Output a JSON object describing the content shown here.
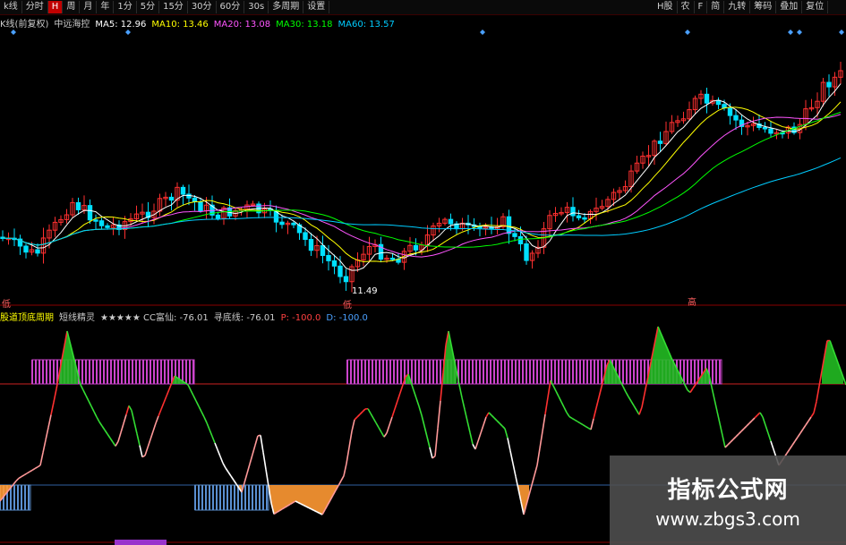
{
  "toolbar": {
    "left": [
      "k线",
      "分时",
      "H",
      "周",
      "月",
      "年",
      "1分",
      "5分",
      "15分",
      "30分",
      "60分",
      "30s",
      "多周期",
      "设置"
    ],
    "active_index": 2,
    "right": [
      "H股",
      "农",
      "F",
      "简",
      "九转",
      "筹码",
      "叠加",
      "复位"
    ]
  },
  "ma_line": [
    {
      "text": "K线(前复权)",
      "color": "#cccccc"
    },
    {
      "text": "中远海控",
      "color": "#cccccc"
    },
    {
      "text": "MA5: 12.96",
      "color": "#ffffff"
    },
    {
      "text": "MA10: 13.46",
      "color": "#ffff00"
    },
    {
      "text": "MA20: 13.08",
      "color": "#ff55ff"
    },
    {
      "text": "MA30: 13.18",
      "color": "#00ff00"
    },
    {
      "text": "MA60: 13.57",
      "color": "#00ccff"
    }
  ],
  "price_labels": {
    "low": "11.49",
    "left_tag": "低",
    "mid_tag": "低",
    "right_tag": "高"
  },
  "indicator_line": [
    {
      "text": "股道顶底周期",
      "color": "#ffff00"
    },
    {
      "text": "短线精灵",
      "color": "#cccccc"
    },
    {
      "text": "★★★★★ CC富仙: -76.01",
      "color": "#cccccc"
    },
    {
      "text": "寻底线: -76.01",
      "color": "#cccccc"
    },
    {
      "text": "P: -100.0",
      "color": "#ff4040"
    },
    {
      "text": "D: -100.0",
      "color": "#4aa0ff"
    }
  ],
  "watermark": {
    "title": "指标公式网",
    "url": "www.zbgs3.com"
  },
  "colors": {
    "up": "#ff3030",
    "down": "#00e0ff",
    "ma5": "#ffffff",
    "ma10": "#ffff00",
    "ma20": "#ff55ff",
    "ma30": "#00ff00",
    "ma60": "#00ccff",
    "top_band": "#cc44cc",
    "bottom_band": "#5a8fd0",
    "peak_fill": "#22bb22",
    "trough_fill": "#ff9933",
    "rule": "#cc2222"
  }
}
